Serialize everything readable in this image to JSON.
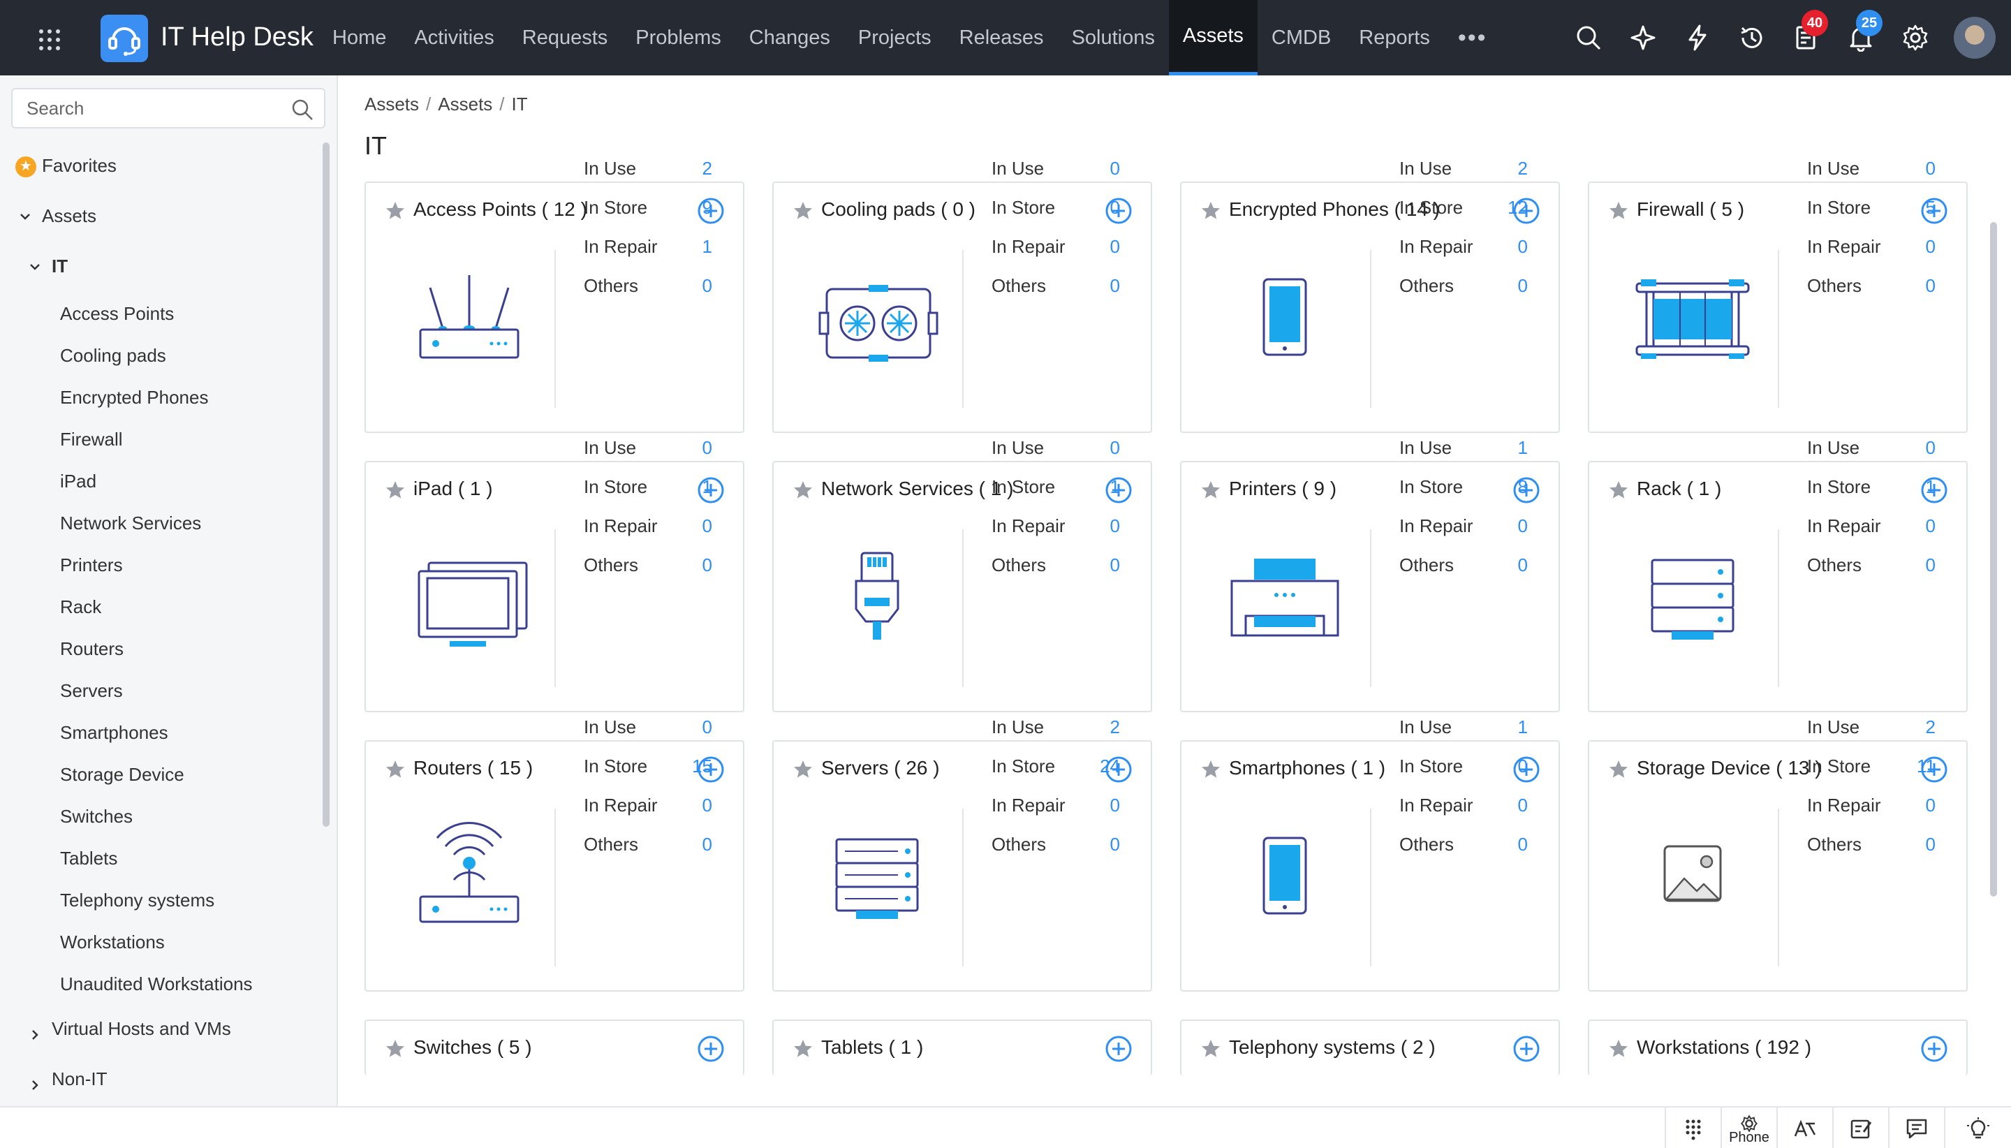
{
  "app": {
    "title": "IT Help Desk"
  },
  "topnav": {
    "tabs": [
      "Home",
      "Activities",
      "Requests",
      "Problems",
      "Changes",
      "Projects",
      "Releases",
      "Solutions",
      "Assets",
      "CMDB",
      "Reports"
    ],
    "active": "Assets",
    "more_label": "•••"
  },
  "topicons": {
    "tasks_badge": "40",
    "notifications_badge": "25"
  },
  "sidebar": {
    "search_placeholder": "Search",
    "favorites_label": "Favorites",
    "assets_label": "Assets",
    "it_label": "IT",
    "items": [
      "Access Points",
      "Cooling pads",
      "Encrypted Phones",
      "Firewall",
      "iPad",
      "Network Services",
      "Printers",
      "Rack",
      "Routers",
      "Servers",
      "Smartphones",
      "Storage Device",
      "Switches",
      "Tablets",
      "Telephony systems",
      "Workstations",
      "Unaudited Workstations"
    ],
    "virtual_label": "Virtual Hosts and VMs",
    "nonit_label": "Non-IT"
  },
  "breadcrumb": [
    "Assets",
    "Assets",
    "IT"
  ],
  "page_title": "IT",
  "stat_labels": [
    "In Use",
    "In Store",
    "In Repair",
    "Others"
  ],
  "cards": [
    {
      "title": "Access Points ( 12 )",
      "icon": "access-point",
      "stats": [
        "2",
        "9",
        "1",
        "0"
      ]
    },
    {
      "title": "Cooling pads ( 0 )",
      "icon": "cooling-pad",
      "stats": [
        "0",
        "0",
        "0",
        "0"
      ]
    },
    {
      "title": "Encrypted Phones ( 14 )",
      "icon": "phone",
      "stats": [
        "2",
        "12",
        "0",
        "0"
      ]
    },
    {
      "title": "Firewall ( 5 )",
      "icon": "firewall",
      "stats": [
        "0",
        "5",
        "0",
        "0"
      ]
    },
    {
      "title": "iPad ( 1 )",
      "icon": "tablet",
      "stats": [
        "0",
        "1",
        "0",
        "0"
      ]
    },
    {
      "title": "Network Services ( 1 )",
      "icon": "network-cable",
      "stats": [
        "0",
        "1",
        "0",
        "0"
      ]
    },
    {
      "title": "Printers ( 9 )",
      "icon": "printer",
      "stats": [
        "1",
        "8",
        "0",
        "0"
      ]
    },
    {
      "title": "Rack ( 1 )",
      "icon": "rack",
      "stats": [
        "0",
        "1",
        "0",
        "0"
      ]
    },
    {
      "title": "Routers ( 15 )",
      "icon": "router",
      "stats": [
        "0",
        "15",
        "0",
        "0"
      ]
    },
    {
      "title": "Servers ( 26 )",
      "icon": "server",
      "stats": [
        "2",
        "24",
        "0",
        "0"
      ]
    },
    {
      "title": "Smartphones ( 1 )",
      "icon": "phone",
      "stats": [
        "1",
        "0",
        "0",
        "0"
      ]
    },
    {
      "title": "Storage Device ( 13 )",
      "icon": "image-placeholder",
      "stats": [
        "2",
        "11",
        "0",
        "0"
      ]
    },
    {
      "title": "Switches ( 5 )"
    },
    {
      "title": "Tablets ( 1 )"
    },
    {
      "title": "Telephony systems ( 2 )"
    },
    {
      "title": "Workstations ( 192 )"
    }
  ],
  "footer": {
    "phone_label": "Phone"
  },
  "colors": {
    "accent": "#2f8ff0",
    "topbar": "#262b33",
    "icon_outline": "#3a3f8f",
    "icon_fill": "#1aa7ec"
  }
}
